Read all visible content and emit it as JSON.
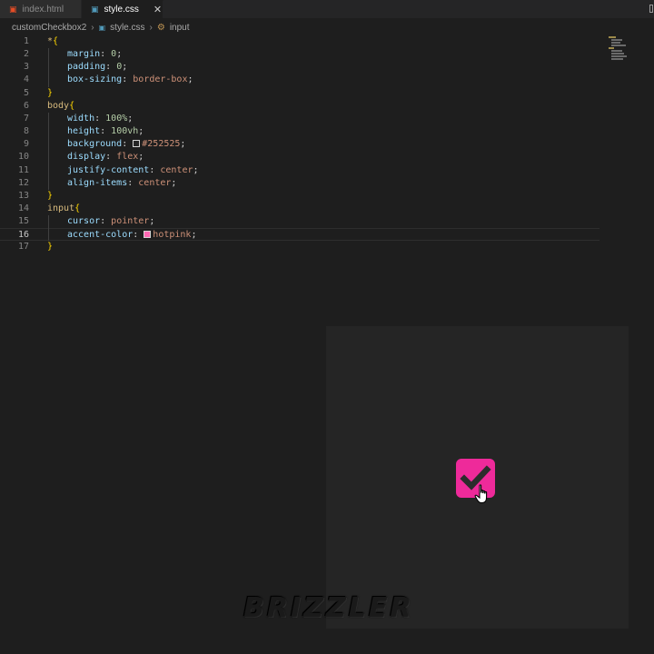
{
  "tabs": [
    {
      "label": "index.html",
      "icon": "html5-icon",
      "active": false
    },
    {
      "label": "style.css",
      "icon": "css3-icon",
      "active": true
    }
  ],
  "breadcrumb": {
    "folder": "customCheckbox2",
    "file": "style.css",
    "symbol": "input"
  },
  "editor": {
    "current_line": 16,
    "lines": [
      {
        "n": "1",
        "tokens": [
          "*{"
        ]
      },
      {
        "n": "2",
        "prop": "margin",
        "value": "0"
      },
      {
        "n": "3",
        "prop": "padding",
        "value": "0"
      },
      {
        "n": "4",
        "prop": "box-sizing",
        "value": "border-box"
      },
      {
        "n": "5",
        "tokens": [
          "}"
        ]
      },
      {
        "n": "6",
        "selector": "body"
      },
      {
        "n": "7",
        "prop": "width",
        "value": "100%"
      },
      {
        "n": "8",
        "prop": "height",
        "value": "100vh"
      },
      {
        "n": "9",
        "prop": "background",
        "value": "#252525",
        "swatch": "#252525"
      },
      {
        "n": "10",
        "prop": "display",
        "value": "flex"
      },
      {
        "n": "11",
        "prop": "justify-content",
        "value": "center"
      },
      {
        "n": "12",
        "prop": "align-items",
        "value": "center"
      },
      {
        "n": "13",
        "tokens": [
          "}"
        ]
      },
      {
        "n": "14",
        "selector": "input"
      },
      {
        "n": "15",
        "prop": "cursor",
        "value": "pointer"
      },
      {
        "n": "16",
        "prop": "accent-color",
        "value": "hotpink",
        "swatch": "#ff69b4"
      },
      {
        "n": "17",
        "tokens": [
          "}"
        ]
      }
    ]
  },
  "preview": {
    "background": "#252525",
    "checkbox_checked": true,
    "accent_color": "#ee2a9a"
  },
  "watermark": "BRIZZLER",
  "icons": {
    "close": "close-icon",
    "symbol": "symbol-property-icon",
    "cursor": "hand-pointer-icon"
  }
}
